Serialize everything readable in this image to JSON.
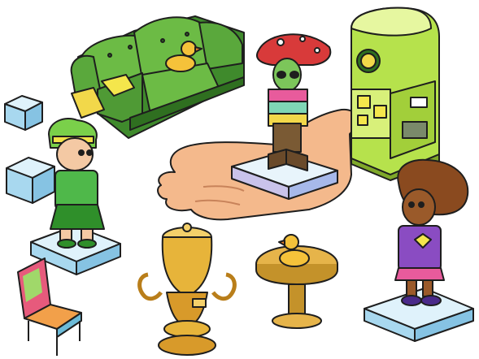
{
  "scene": {
    "background": "#ffffff",
    "outline": "#1e1e1e",
    "items": [
      {
        "name": "ice-cube-small",
        "color": "#bfe3f3"
      },
      {
        "name": "ice-cube-large",
        "color": "#9fd3ee"
      },
      {
        "name": "green-sofa",
        "color": "#5aa83c"
      },
      {
        "name": "rubber-duck-on-sofa",
        "color": "#f5c23a"
      },
      {
        "name": "yellow-cushion",
        "color": "#f2e24a"
      },
      {
        "name": "giant-hand-platform",
        "color": "#f4b98c"
      },
      {
        "name": "alien-mushroom-avatar",
        "color": "#7cc65a"
      },
      {
        "name": "lime-vending-machine",
        "color": "#b6e24c"
      },
      {
        "name": "green-hair-avatar",
        "color": "#4fb84a"
      },
      {
        "name": "afro-avatar",
        "color": "#8a4cc2"
      },
      {
        "name": "rainbow-chair",
        "color": "#e75a7c"
      },
      {
        "name": "golden-samovar",
        "color": "#e7b43a"
      },
      {
        "name": "round-wooden-table",
        "color": "#e6b44a"
      },
      {
        "name": "rubber-duck-on-table",
        "color": "#f5c23a"
      }
    ]
  }
}
